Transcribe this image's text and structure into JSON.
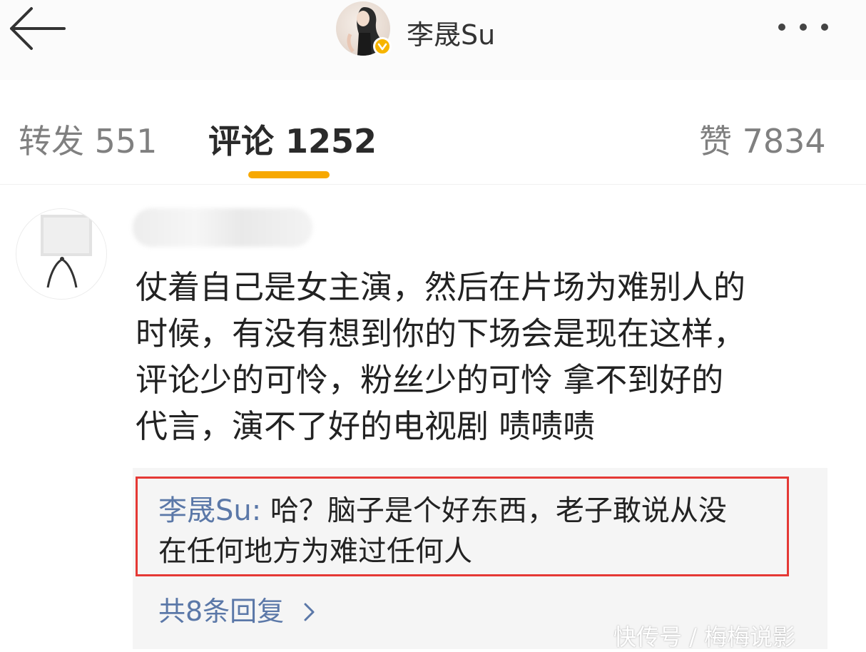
{
  "header": {
    "nickname": "李晟Su",
    "back_icon": "arrow-left-icon",
    "more_icon": "ellipsis-icon",
    "verified_icon": "verified-badge-icon",
    "verified_color": "#f7b500"
  },
  "tabs": [
    {
      "label": "转发",
      "count": "551"
    },
    {
      "label": "评论",
      "count": "1252",
      "active": true
    },
    {
      "label": "赞",
      "count": "7834"
    }
  ],
  "accent_color": "#f7a800",
  "comment": {
    "lines": [
      "仗着自己是女主演，然后在片场为难别人的",
      "时候，有没有想到你的下场会是现在这样，",
      "评论少的可怜，粉丝少的可怜 拿不到好的",
      "代言，演不了好的电视剧 啧啧啧"
    ]
  },
  "reply": {
    "author": "李晟Su:",
    "line1": " 哈？脑子是个好东西，老子敢说从没",
    "line2": "在任何地方为难过任何人",
    "highlight_color": "#e53935"
  },
  "more_replies": "共8条回复",
  "more_replies_icon": "chevron-right-icon",
  "watermark": "快传号 / 梅梅说影"
}
